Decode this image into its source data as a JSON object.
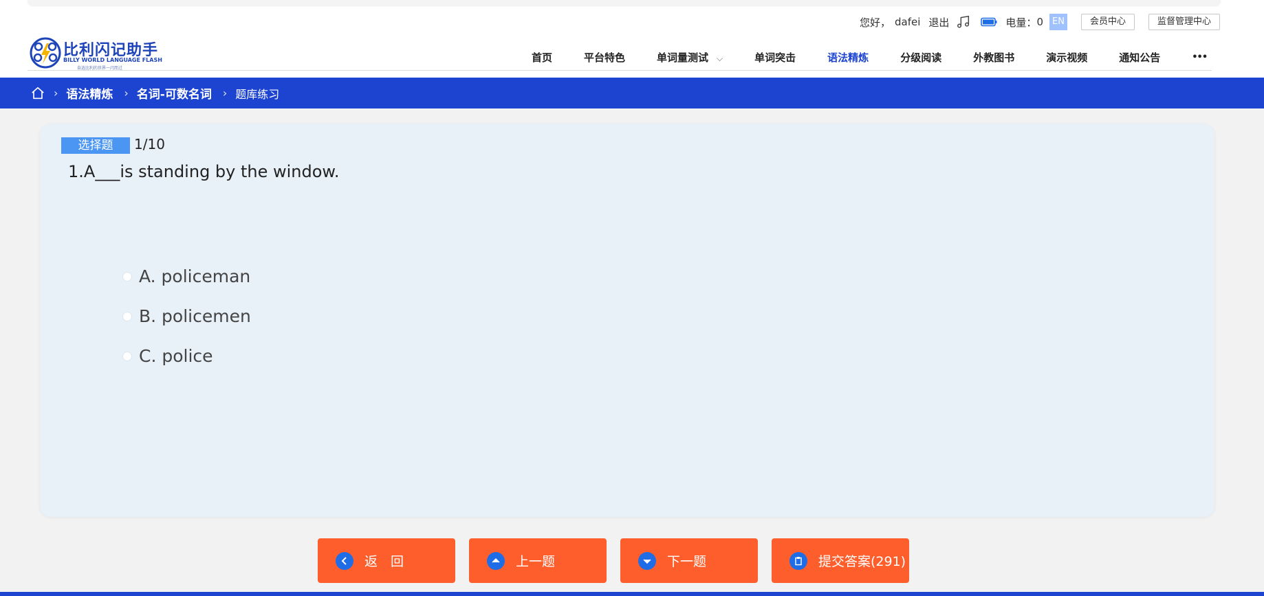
{
  "header": {
    "greeting": "您好，",
    "username": "dafei",
    "logout": "退出",
    "power_label": "电量：",
    "power_value": "0",
    "lang_badge": "EN",
    "member_center": "会员中心",
    "supervisor_center": "监督管理中心"
  },
  "logo": {
    "name": "比利闪记助手",
    "english": "BILLY WORLD LANGUAGE FLASH",
    "tagline": "自选比利的世界一闪而过"
  },
  "nav": {
    "items": [
      "首页",
      "平台特色",
      "单词量测试",
      "单词突击",
      "语法精炼",
      "分级阅读",
      "外教图书",
      "演示视频",
      "通知公告",
      "•••"
    ],
    "active": "语法精炼"
  },
  "breadcrumb": {
    "items": [
      "语法精炼",
      "名词-可数名词",
      "题库练习"
    ]
  },
  "question": {
    "type": "选择题",
    "progress": "1/10",
    "text": "1.A___is standing by the window.",
    "options": [
      "A. policeman",
      "B. policemen",
      "C. police"
    ]
  },
  "buttons": {
    "back": "返　回",
    "prev": "上一题",
    "next": "下一题",
    "submit": "提交答案(291)"
  },
  "colors": {
    "brand_blue": "#1d44d0",
    "button_orange": "#fd5e2c",
    "tag_blue": "#4a96f2",
    "card_bg": "#e8f0f8"
  }
}
